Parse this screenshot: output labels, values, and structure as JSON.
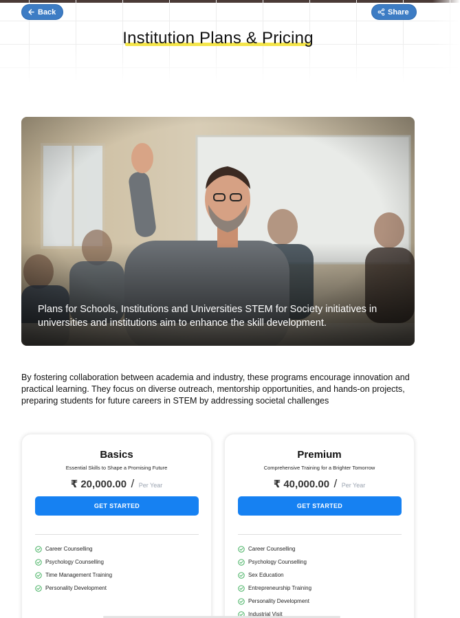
{
  "header": {
    "back_label": "Back",
    "share_label": "Share",
    "title": "Institution Plans & Pricing"
  },
  "hero": {
    "caption": "Plans for Schools, Institutions and Universities STEM for Society initiatives in universities and institutions aim to enhance the skill development."
  },
  "intro": {
    "text": "By fostering collaboration between academia and industry, these programs encourage innovation and practical learning. They focus on diverse outreach, mentorship opportunities, and hands-on projects, preparing students for future careers in STEM by addressing societal challenges"
  },
  "plans": [
    {
      "name": "Basics",
      "tagline": "Essential Skills to Shape a Promising Future",
      "price": "₹ 20,000.00",
      "separator": "/",
      "period": "Per Year",
      "cta": "GET STARTED",
      "features": [
        "Career Counselling",
        "Psychology Counselling",
        "Time Management Training",
        "Personality Development"
      ]
    },
    {
      "name": "Premium",
      "tagline": "Comprehensive Training for a Brighter Tomorrow",
      "price": "₹ 40,000.00",
      "separator": "/",
      "period": "Per Year",
      "cta": "GET STARTED",
      "features": [
        "Career Counselling",
        "Psychology Counselling",
        "Sex Education",
        "Entrepreneurship Training",
        "Personality Development",
        "Industrial Visit"
      ]
    }
  ],
  "colors": {
    "accent_button": "#1681f2",
    "pill_button": "#3d7cc4",
    "title_highlight": "#f4e54a",
    "check_icon": "#2fa84f"
  },
  "icons": {
    "back": "arrow-left-icon",
    "share": "share-icon",
    "feature": "check-circle-icon"
  }
}
